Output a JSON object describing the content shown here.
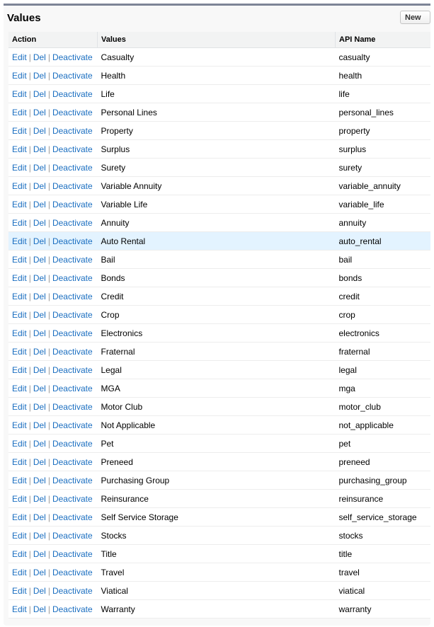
{
  "title": "Values",
  "new_button": "New",
  "columns": {
    "action": "Action",
    "values": "Values",
    "api_name": "API Name"
  },
  "action_links": {
    "edit": "Edit",
    "del": "Del",
    "deactivate": "Deactivate"
  },
  "highlight_color": "#e3f3ff",
  "highlighted_row": "Auto Rental",
  "rows": [
    {
      "value": "Casualty",
      "api": "casualty"
    },
    {
      "value": "Health",
      "api": "health"
    },
    {
      "value": "Life",
      "api": "life"
    },
    {
      "value": "Personal Lines",
      "api": "personal_lines"
    },
    {
      "value": "Property",
      "api": "property"
    },
    {
      "value": "Surplus",
      "api": "surplus"
    },
    {
      "value": "Surety",
      "api": "surety"
    },
    {
      "value": "Variable Annuity",
      "api": "variable_annuity"
    },
    {
      "value": "Variable Life",
      "api": "variable_life"
    },
    {
      "value": "Annuity",
      "api": "annuity"
    },
    {
      "value": "Auto Rental",
      "api": "auto_rental"
    },
    {
      "value": "Bail",
      "api": "bail"
    },
    {
      "value": "Bonds",
      "api": "bonds"
    },
    {
      "value": "Credit",
      "api": "credit"
    },
    {
      "value": "Crop",
      "api": "crop"
    },
    {
      "value": "Electronics",
      "api": "electronics"
    },
    {
      "value": "Fraternal",
      "api": "fraternal"
    },
    {
      "value": "Legal",
      "api": "legal"
    },
    {
      "value": "MGA",
      "api": "mga"
    },
    {
      "value": "Motor Club",
      "api": "motor_club"
    },
    {
      "value": "Not Applicable",
      "api": "not_applicable"
    },
    {
      "value": "Pet",
      "api": "pet"
    },
    {
      "value": "Preneed",
      "api": "preneed"
    },
    {
      "value": "Purchasing Group",
      "api": "purchasing_group"
    },
    {
      "value": "Reinsurance",
      "api": "reinsurance"
    },
    {
      "value": "Self Service Storage",
      "api": "self_service_storage"
    },
    {
      "value": "Stocks",
      "api": "stocks"
    },
    {
      "value": "Title",
      "api": "title"
    },
    {
      "value": "Travel",
      "api": "travel"
    },
    {
      "value": "Viatical",
      "api": "viatical"
    },
    {
      "value": "Warranty",
      "api": "warranty"
    }
  ]
}
